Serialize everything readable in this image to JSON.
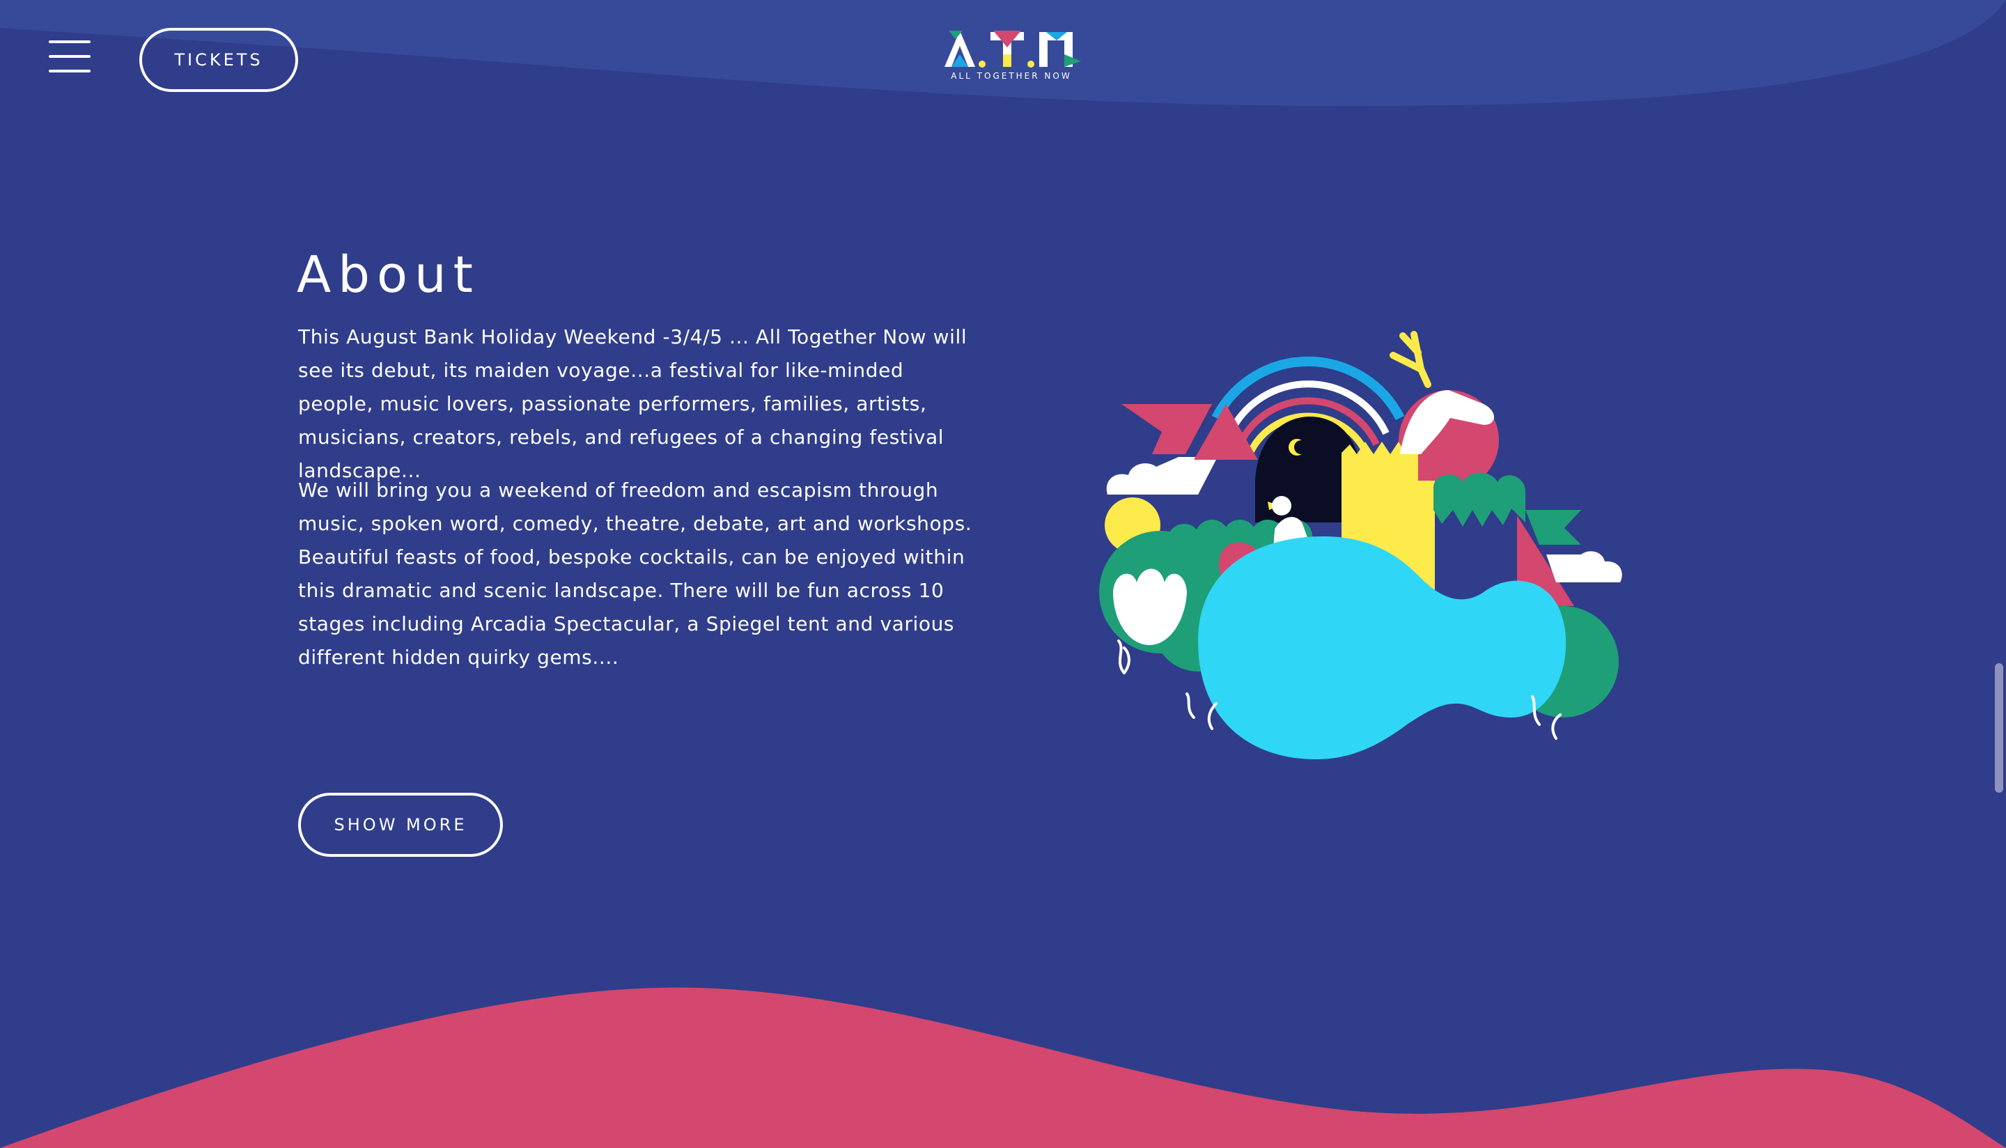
{
  "header": {
    "menu_icon": "hamburger-menu-icon",
    "tickets_label": "TICKETS",
    "logo_text": "A.T.N",
    "logo_tagline": "ALL TOGETHER NOW"
  },
  "about": {
    "title": "About",
    "paragraph_1": "This August Bank Holiday Weekend -3/4/5 ... All Together Now will see its debut, its maiden voyage...a festival for like-minded people, music lovers, passionate performers, families, artists, musicians, creators, rebels, and refugees of a changing festival landscape...",
    "paragraph_2": "We will bring you a weekend of freedom and escapism through music, spoken word, comedy, theatre, debate, art and workshops. Beautiful feasts of food, bespoke cocktails, can be enjoyed within this dramatic and scenic landscape. There will be fun across 10 stages including Arcadia Spectacular, a Spiegel tent and various different hidden quirky gems....",
    "show_more_label": "SHOW MORE"
  },
  "colors": {
    "background": "#303d8b",
    "top_wave": "#374a9a",
    "bottom_wave": "#d4476e",
    "cyan": "#2fd6f5",
    "green": "#1e9f78",
    "yellow": "#fdea4b",
    "pink": "#d4476e",
    "blue": "#1ba7e6",
    "dark": "#0b0d24"
  },
  "illustration": {
    "icon": "festival-landscape-illustration"
  }
}
